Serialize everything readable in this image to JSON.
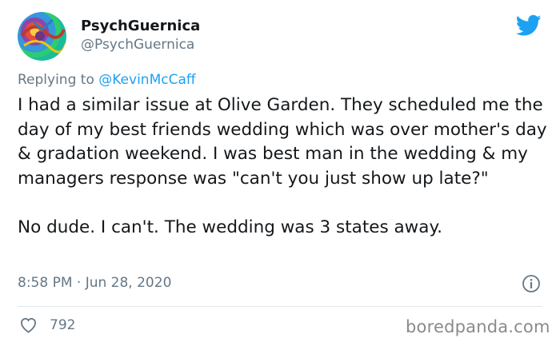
{
  "author": {
    "display_name": "PsychGuernica",
    "handle": "@PsychGuernica"
  },
  "reply": {
    "prefix": "Replying to",
    "mention": "@KevinMcCaff"
  },
  "tweet": {
    "text": "I had a similar issue at Olive Garden. They scheduled me the day of my best friends wedding which was over mother's day & gradation weekend. I was best man in the wedding & my managers response was \"can't you just show up late?\"\n\nNo dude. I can't. The wedding was 3 states away.",
    "timestamp": "8:58 PM · Jun 28, 2020",
    "likes": "792"
  },
  "icons": {
    "logo": "twitter-bird-icon",
    "info": "info-icon",
    "like": "heart-icon"
  },
  "colors": {
    "accent": "#1da1f2",
    "secondary_text": "#657786",
    "primary_text": "#14171a"
  },
  "watermark": "boredpanda.com"
}
